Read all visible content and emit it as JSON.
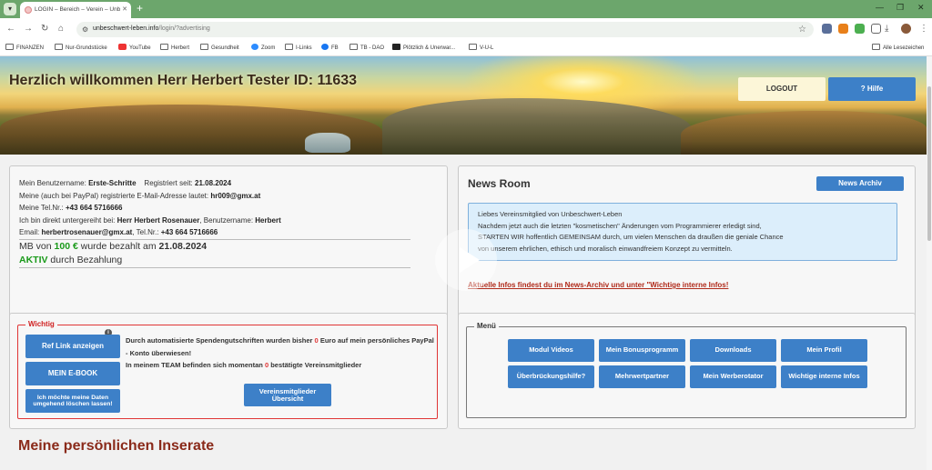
{
  "browser": {
    "tab_title": "LOGIN – Bereich – Verein – Unb",
    "url_host": "unbeschwert-leben.info",
    "url_path": "/login/?advertising",
    "bookmarks": [
      "FINANZEN",
      "Nur-Grundstücke",
      "YouTube",
      "Herbert",
      "Gesundheit",
      "Zoom",
      "I-Links",
      "FB",
      "TB - DAO",
      "Plötzlich & Unerwar...",
      "V-U-L"
    ],
    "other_bookmarks": "Alle Lesezeichen"
  },
  "header": {
    "welcome": "Herzlich willkommen Herr Herbert Tester ID: 11633",
    "logout": "LOGOUT",
    "help": "? Hilfe"
  },
  "account": {
    "username_label": "Mein Benutzername:",
    "username": "Erste-Schritte",
    "registered_label": "Registriert seit:",
    "registered": "21.08.2024",
    "email_label": "Meine (auch bei PayPal) registrierte E-Mail-Adresse lautet:",
    "email": "hr009@gmx.at",
    "tel_label": "Meine Tel.Nr.:",
    "tel": "+43 664 5716666",
    "upline_label": "Ich bin direkt untergereiht bei:",
    "upline_name": "Herr Herbert Rosenauer",
    "upline_user_label": ", Benutzername:",
    "upline_user": "Herbert",
    "upline_email_label": "Email:",
    "upline_email": "herbertrosenauer@gmx.at",
    "upline_tel_label": ", Tel.Nr.:",
    "upline_tel": "+43 664 5716666",
    "mb_prefix": "MB von",
    "mb_amount": "100 €",
    "mb_mid": "wurde bezahlt am",
    "mb_date": "21.08.2024",
    "status": "AKTIV",
    "status_suffix": "durch Bezahlung"
  },
  "news": {
    "title": "News Room",
    "archive_button": "News Archiv",
    "lines": [
      "Liebes Vereinsmitglied von Unbeschwert-Leben",
      "Nachdem jetzt auch die letzten \"kosmetischen\" Änderungen vom Programmierer erledigt sind,",
      "STARTEN WIR hoffentlich GEMEINSAM durch, um vielen Menschen da draußen die geniale Chance",
      "von unserem ehrlichen, ethisch und moralisch einwandfreiem Konzept zu vermitteln."
    ],
    "link": "Aktuelle Infos findest du im News-Archiv und unter \"Wichtige interne Infos!"
  },
  "wichtig": {
    "legend": "Wichtig",
    "ref_link": "Ref Link anzeigen",
    "ebook": "MEIN E-BOOK",
    "delete": "Ich möchte meine Daten umgehend löschen lassen!",
    "text1": "Durch automatisierte Spendengutschriften wurden bisher",
    "amount": "0",
    "text2": "Euro auf mein persönliches PayPal - Konto überwiesen!",
    "text3": "In meinem TEAM befinden sich momentan",
    "team_count": "0",
    "text4": "bestätigte Vereinsmitglieder",
    "members_button": "Vereinsmitglieder Übersicht",
    "info_icon": "i"
  },
  "menu": {
    "legend": "Menü",
    "buttons": [
      "Modul Videos",
      "Mein Bonusprogramm",
      "Downloads",
      "Mein Profil",
      "Überbrückungshilfe?",
      "Mehrwertpartner",
      "Mein Werberotator",
      "Wichtige interne Infos"
    ]
  },
  "inserate_title": "Meine persönlichen Inserate",
  "colors": {
    "accent": "#3d80c8",
    "alert": "#e03535",
    "active": "#1a9a1a",
    "heading": "#8a2a1a"
  }
}
